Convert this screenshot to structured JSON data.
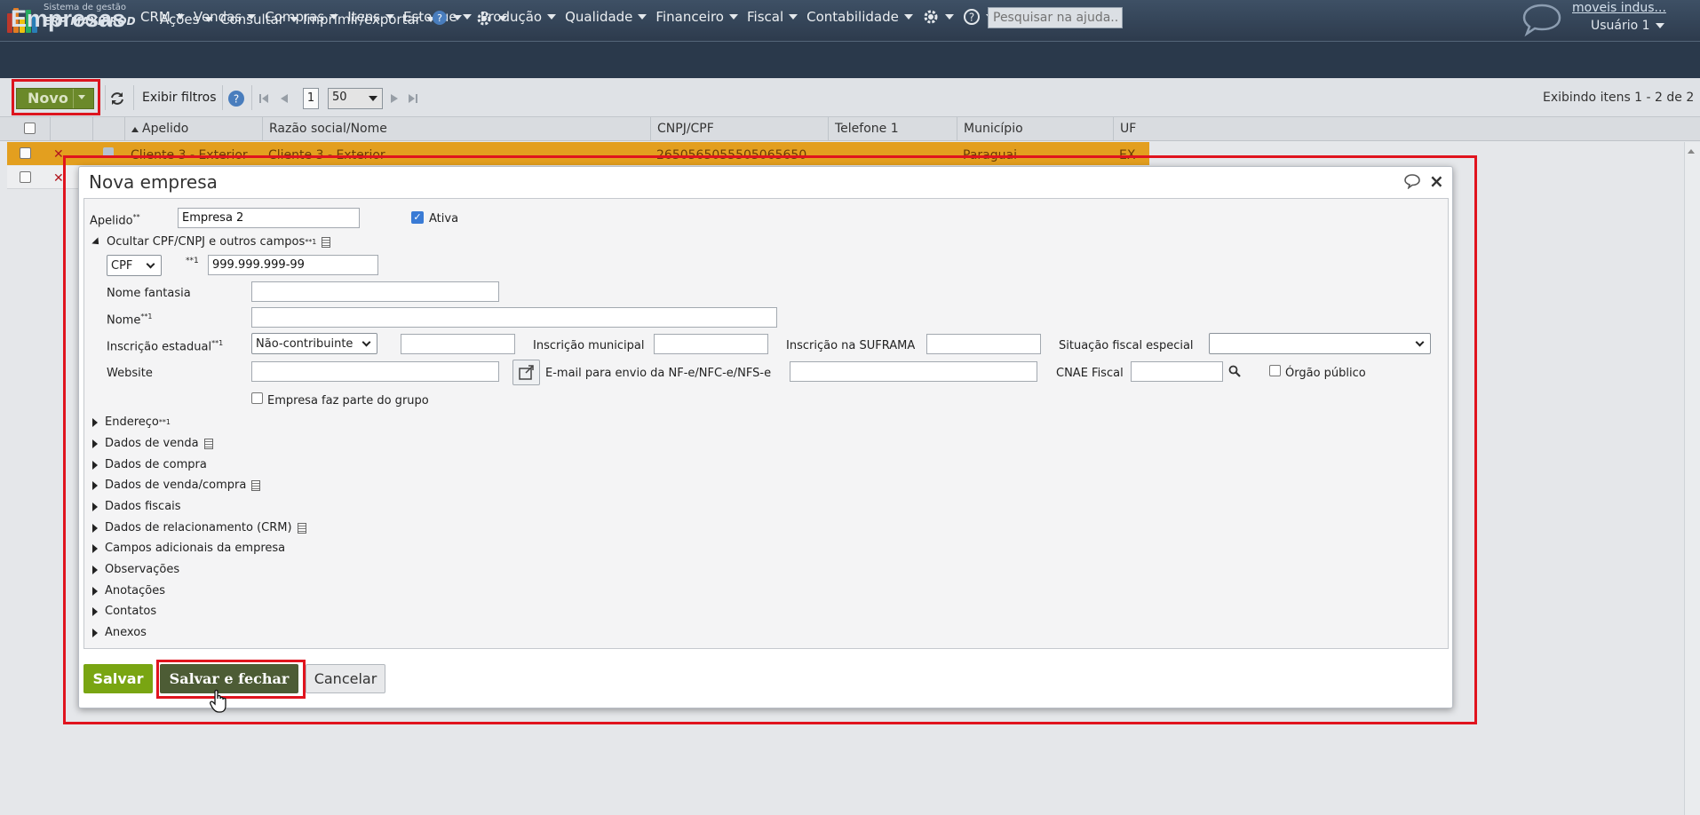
{
  "app": {
    "logo_line1": "Sistema de gestão",
    "logo_line2": "ERP MAXIPROD",
    "menu": [
      "CRM",
      "Vendas",
      "Compras",
      "Itens",
      "Estoque",
      "Produção",
      "Qualidade",
      "Financeiro",
      "Fiscal",
      "Contabilidade"
    ],
    "help_search_placeholder": "Pesquisar na ajuda...",
    "company_link": "moveis indus...",
    "user_name": "Usuário 1"
  },
  "page": {
    "title": "Empresas",
    "menu": [
      "Ações",
      "Consultar",
      "Imprimir/exportar"
    ]
  },
  "toolbar": {
    "new_label": "Novo",
    "show_filters": "Exibir filtros",
    "page_number": "1",
    "page_size": "50",
    "status": "Exibindo itens 1 - 2 de 2"
  },
  "grid": {
    "columns": [
      "Apelido",
      "Razão social/Nome",
      "CNPJ/CPF",
      "Telefone 1",
      "Município",
      "UF"
    ],
    "rows": [
      {
        "apelido": "Cliente 3 - Exterior",
        "razao": "Cliente 3 - Exterior",
        "cnpj": "2650565055505065650",
        "telefone": "",
        "municipio": "Paraguai",
        "uf": "EX"
      }
    ]
  },
  "dialog": {
    "title": "Nova empresa",
    "apelido_label": "Apelido",
    "apelido_value": "Empresa 2",
    "ativa_label": "Ativa",
    "toggle_section": "Ocultar CPF/CNPJ e outros campos",
    "doc_type": "CPF",
    "doc_value": "999.999.999-99",
    "nome_fantasia_label": "Nome fantasia",
    "nome_label": "Nome",
    "ie_label": "Inscrição estadual",
    "ie_value": "Não-contribuinte",
    "im_label": "Inscrição municipal",
    "suframa_label": "Inscrição na SUFRAMA",
    "situacao_label": "Situação fiscal especial",
    "website_label": "Website",
    "email_label": "E-mail para envio da NF-e/NFC-e/NFS-e",
    "cnae_label": "CNAE Fiscal",
    "orgao_label": "Órgão público",
    "grupo_label": "Empresa faz parte do grupo",
    "sections": [
      "Endereço",
      "Dados de venda",
      "Dados de compra",
      "Dados de venda/compra",
      "Dados fiscais",
      "Dados de relacionamento (CRM)",
      "Campos adicionais da empresa",
      "Observações",
      "Anotações",
      "Contatos",
      "Anexos"
    ],
    "save": "Salvar",
    "save_close": "Salvar e fechar",
    "cancel": "Cancelar"
  },
  "colors": {
    "accent_green": "#79a512",
    "highlight_row": "#e7a21f",
    "annotation_red": "#e0141e"
  }
}
